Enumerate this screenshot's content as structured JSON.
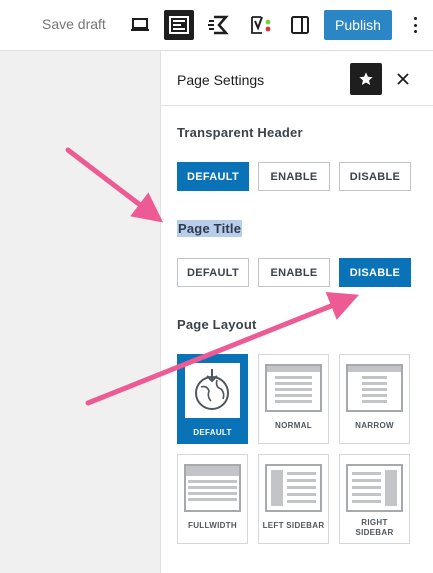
{
  "toolbar": {
    "save_draft": "Save draft",
    "icons": [
      "laptop-preview-icon",
      "astra-settings-icon",
      "spectra-icon",
      "yoast-seo-icon",
      "sidebar-toggle-icon"
    ],
    "publish": "Publish",
    "accent": "#2b86c6"
  },
  "panel": {
    "title": "Page Settings",
    "transparent_header": {
      "title": "Transparent Header",
      "options": [
        "DEFAULT",
        "ENABLE",
        "DISABLE"
      ],
      "selected": "DEFAULT"
    },
    "page_title": {
      "title": "Page Title",
      "options": [
        "DEFAULT",
        "ENABLE",
        "DISABLE"
      ],
      "selected": "DISABLE"
    },
    "page_layout": {
      "title": "Page Layout",
      "layouts": [
        "DEFAULT",
        "NORMAL",
        "NARROW",
        "FULLWIDTH",
        "LEFT SIDEBAR",
        "RIGHT SIDEBAR"
      ],
      "right_sidebar_line1": "RIGHT",
      "right_sidebar_line2": "SIDEBAR",
      "selected": "DEFAULT"
    }
  },
  "colors": {
    "selected": "#0a73b7",
    "arrow": "#ee5a93",
    "highlight": "#b7cdea"
  }
}
